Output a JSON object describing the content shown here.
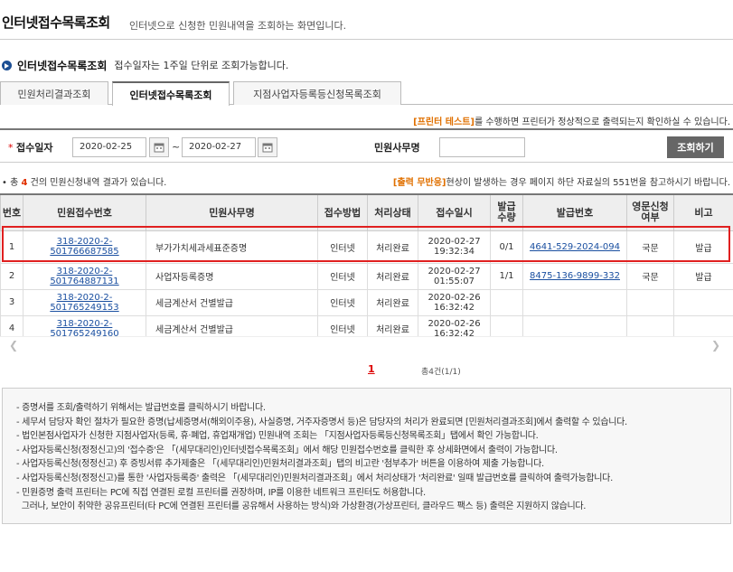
{
  "page": {
    "title": "인터넷접수목록조회",
    "description": "인터넷으로 신청한 민원내역을 조회하는 화면입니다."
  },
  "subheader": {
    "title": "인터넷접수목록조회",
    "desc": "접수일자는 1주일 단위로 조회가능합니다."
  },
  "tabs": [
    {
      "label": "민원처리결과조회",
      "active": false
    },
    {
      "label": "인터넷접수목록조회",
      "active": true
    },
    {
      "label": "지점사업자등록등신청목록조회",
      "active": false
    }
  ],
  "printer_notice": {
    "highlight": "[프린터 테스트]",
    "text": "를 수행하면 프린터가 정상적으로 출력되는지 확인하실 수 있습니다."
  },
  "search": {
    "date_label": "접수일자",
    "date_from": "2020-02-25",
    "tilde": "~",
    "date_to": "2020-02-27",
    "task_label": "민원사무명",
    "task_value": "",
    "search_button": "조회하기"
  },
  "result": {
    "prefix": "• 총",
    "count": "4",
    "suffix": "건의 민원신청내역 결과가 있습니다."
  },
  "print_notice": {
    "highlight": "[출력 무반응]",
    "text": "현상이 발생하는 경우 페이지 하단 자료실의 551번을 참고하시기 바랍니다."
  },
  "table": {
    "headers": [
      "번호",
      "민원접수번호",
      "민원사무명",
      "접수방법",
      "처리상태",
      "접수일시",
      "발급\n수량",
      "발급번호",
      "영문신청\n여부",
      "비고"
    ],
    "rows": [
      {
        "no": "1",
        "receipt": "318-2020-2-501766687585",
        "task": "부가가치세과세표준증명",
        "method": "인터넷",
        "status": "처리완료",
        "date": "2020-02-27",
        "time": "19:32:34",
        "qty": "0/1",
        "issue_no": "4641-529-2024-094",
        "english": "국문",
        "note": "발급"
      },
      {
        "no": "2",
        "receipt": "318-2020-2-501764887131",
        "task": "사업자등록증명",
        "method": "인터넷",
        "status": "처리완료",
        "date": "2020-02-27",
        "time": "01:55:07",
        "qty": "1/1",
        "issue_no": "8475-136-9899-332",
        "english": "국문",
        "note": "발급"
      },
      {
        "no": "3",
        "receipt": "318-2020-2-501765249153",
        "task": "세금계산서 건별발급",
        "method": "인터넷",
        "status": "처리완료",
        "date": "2020-02-26",
        "time": "16:32:42",
        "qty": "",
        "issue_no": "",
        "english": "",
        "note": ""
      },
      {
        "no": "4",
        "receipt": "318-2020-2-501765249160",
        "task": "세금계산서 건별발급",
        "method": "인터넷",
        "status": "처리완료",
        "date": "2020-02-26",
        "time": "16:32:42",
        "qty": "",
        "issue_no": "",
        "english": "",
        "note": ""
      }
    ]
  },
  "pagination": {
    "current": "1",
    "total": "총4건(1/1)"
  },
  "info_lines": [
    "- 증명서를 조회/출력하기 위해서는 발급번호를 클릭하시기 바랍니다.",
    "- 세무서 담당자 확인 절차가 필요한 증명(납세증명서(해외이주용), 사실증명, 거주자증명서 등)은 담당자의 처리가 완료되면 [민원처리결과조회]에서 출력할 수 있습니다.",
    "- 법인본점사업자가 신청한 지점사업자(등록, 휴·폐업, 휴업재개업) 민원내역 조회는 「지점사업자등록등신청목록조회」탭에서 확인 가능합니다.",
    "- 사업자등록신청(정정신고)의 '접수증'은 「(세무대리인)인터넷접수목록조회」에서 해당 민원접수번호를 클릭한 후 상세화면에서 출력이 가능합니다.",
    "- 사업자등록신청(정정신고) 후 증빙서류 추가제출은 「(세무대리인)민원처리결과조회」탭의 비고란 '첨부추가' 버튼을 이용하여 제출 가능합니다.",
    "- 사업자등록신청(정정신고)를 통한 '사업자등록증' 출력은 「(세무대리인)민원처리결과조회」에서 처리상태가 '처리완료' 일때 발급번호를 클릭하여 출력가능합니다.",
    "- 민원증명 출력 프린터는 PC에 직접 연결된 로컬 프린터를 권장하며, IP를 이용한 네트워크 프린터도 허용합니다.",
    "  그러나, 보안이 취약한 공유프린터(타 PC에 연결된 프린터를 공유해서 사용하는 방식)와 가상환경(가상프린터, 클라우드 팩스 등) 출력은 지원하지 않습니다."
  ],
  "colors": {
    "accent_orange": "#e07000",
    "link_blue": "#1a4fa0",
    "highlight_red": "#e02020"
  }
}
